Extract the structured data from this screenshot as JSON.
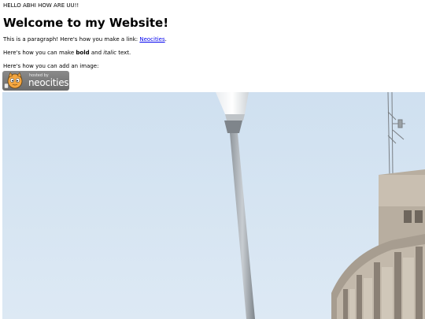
{
  "greeting": "HELLO ABHI HOW ARE UU!!",
  "heading": "Welcome to my Website!",
  "paragraph1": {
    "before_link": "This is a paragraph! Here's how you make a link: ",
    "link_text": "Neocities",
    "after_link": "."
  },
  "paragraph2": {
    "before_bold": "Here's how you can make ",
    "bold": "bold",
    "middle": " and ",
    "italic": "italic",
    "after": " text."
  },
  "paragraph3": "Here's how you can add an image:",
  "badge": {
    "hosted_by": "hosted by",
    "brand": "neocities",
    "icon": "neocities-cat-icon"
  },
  "image": {
    "subject": "street-lamp-and-building-photo"
  },
  "colors": {
    "link": "#0000ee",
    "sky": "#d5e4f2",
    "badge_bg": "#7b7b7b"
  }
}
